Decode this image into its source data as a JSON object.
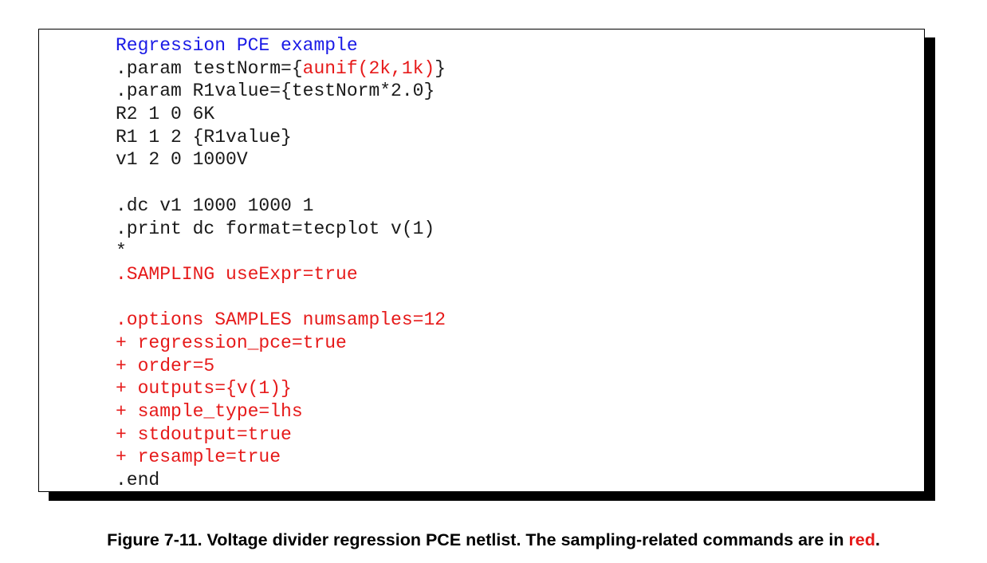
{
  "colors": {
    "default_text": "#1a1a1a",
    "title_blue": "#1a1ae6",
    "highlight_red": "#e61a1a",
    "shadow": "#000000"
  },
  "netlist": {
    "lines": [
      "Regression PCE example",
      ".param testNorm={",
      "aunif(2k,1k)",
      "}",
      ".param R1value={testNorm*2.0}",
      "R2 1 0 6K",
      "R1 1 2 {R1value}",
      "v1 2 0 1000V",
      "",
      ".dc v1 1000 1000 1",
      ".print dc format=tecplot v(1)",
      "*",
      ".SAMPLING useExpr=true",
      "",
      ".options SAMPLES numsamples=12",
      "+ regression_pce=true",
      "+ order=5",
      "+ outputs={v(1)}",
      "+ sample_type=lhs",
      "+ stdoutput=true",
      "+ resample=true",
      ".end"
    ]
  },
  "caption": {
    "text": "Figure 7-11. Voltage divider regression PCE netlist. The sampling-related commands are in ",
    "highlight": "red",
    "end": "."
  }
}
